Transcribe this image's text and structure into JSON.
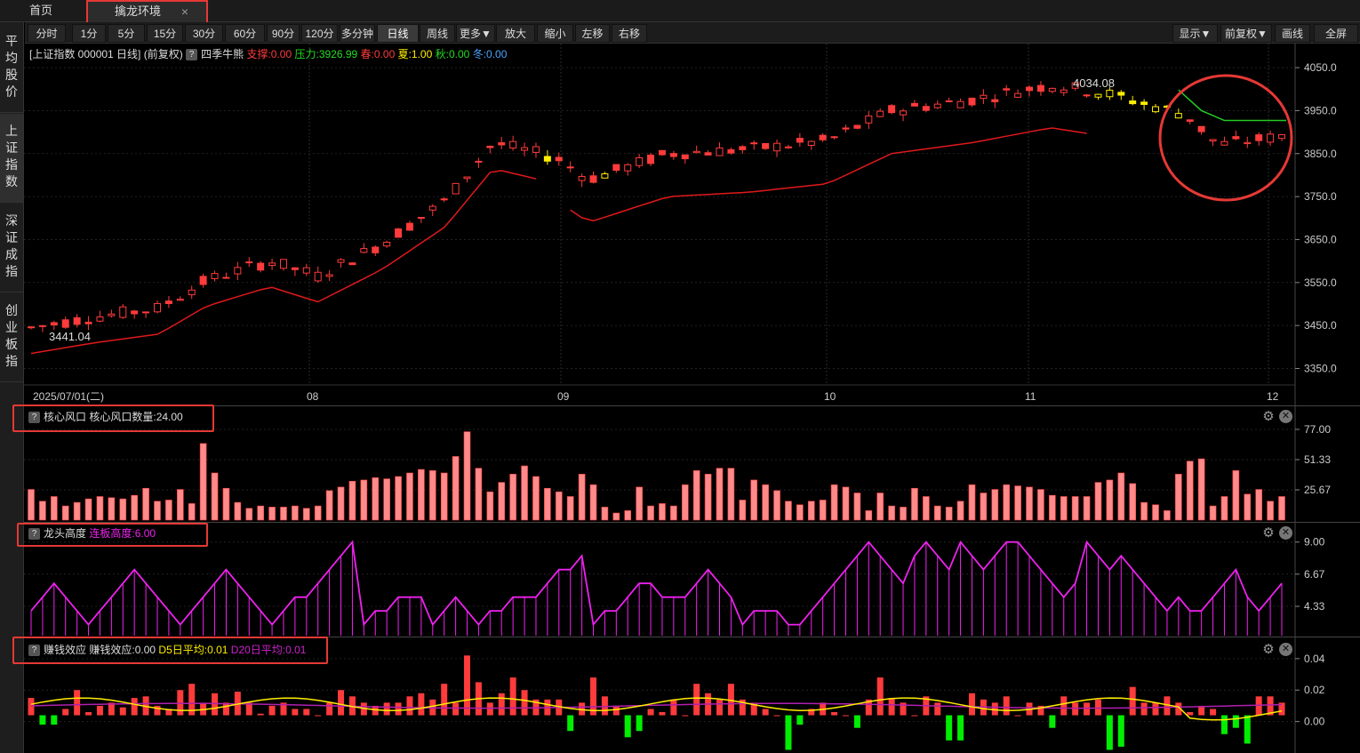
{
  "tabs": {
    "home": "首页",
    "active": "擒龙环境",
    "close": "×"
  },
  "toolbar_left": [
    "分时",
    "1分",
    "5分",
    "15分",
    "30分",
    "60分",
    "90分",
    "120分",
    "多分钟",
    "日线",
    "周线",
    "更多▼",
    "放大",
    "缩小",
    "左移",
    "右移"
  ],
  "toolbar_active": "日线",
  "toolbar_right": [
    "显示▼",
    "前复权▼",
    "画线",
    "全屏"
  ],
  "left_nav": [
    "平均股价",
    "上证指数",
    "深证成指",
    "创业板指"
  ],
  "left_nav_active": 1,
  "colors": {
    "up": "#ff3b3b",
    "down_red": "#ff3b3b",
    "yellow": "#ffee00",
    "support": "#e0191b",
    "resistance": "#22cc22",
    "magenta": "#ee22ee",
    "bar_pink": "#ff8a8a",
    "green_bar": "#00ee00"
  },
  "main_legend": {
    "title": "[上证指数 000001 日线]",
    "adj": "(前复权)",
    "indicator": "四季牛熊",
    "support": "支撑:0.00",
    "resistance": "压力:3926.99",
    "spring": "春:0.00",
    "summer": "夏:1.00",
    "autumn": "秋:0.00",
    "winter": "冬:0.00"
  },
  "annotations": {
    "high": "4034.08",
    "low": "3441.04"
  },
  "panel1_legend": {
    "name": "核心风口",
    "value": "核心风口数量:24.00"
  },
  "panel2_legend": {
    "name": "龙头高度",
    "value": "连板高度:6.00"
  },
  "panel3_legend": {
    "name": "赚钱效应",
    "value": "赚钱效应:0.00",
    "d5": "D5日平均:0.01",
    "d20": "D20日平均:0.01"
  },
  "gear_icon": "⚙",
  "x_icon": "✕",
  "chart_data": [
    {
      "type": "candlestick",
      "title": "上证指数 000001 日线",
      "x_start": "2025/07/01(二)",
      "x_ticks": [
        "2025/07/01(二)",
        "08",
        "09",
        "10",
        "11",
        "12"
      ],
      "y_ticks": [
        4050,
        3950,
        3850,
        3750,
        3650,
        3550,
        3450,
        3350
      ],
      "ylim": [
        3320,
        4075
      ]
    },
    {
      "type": "bar",
      "title": "核心风口",
      "y_ticks": [
        77.0,
        51.33,
        25.67
      ],
      "ylim": [
        0,
        80
      ]
    },
    {
      "type": "line",
      "title": "龙头高度",
      "y_ticks": [
        9.0,
        6.67,
        4.33
      ],
      "ylim": [
        2.2,
        9.5
      ]
    },
    {
      "type": "bar",
      "title": "赚钱效应",
      "y_ticks": [
        0.04,
        0.02,
        -0.0
      ],
      "ylim": [
        -0.02,
        0.045
      ]
    }
  ]
}
